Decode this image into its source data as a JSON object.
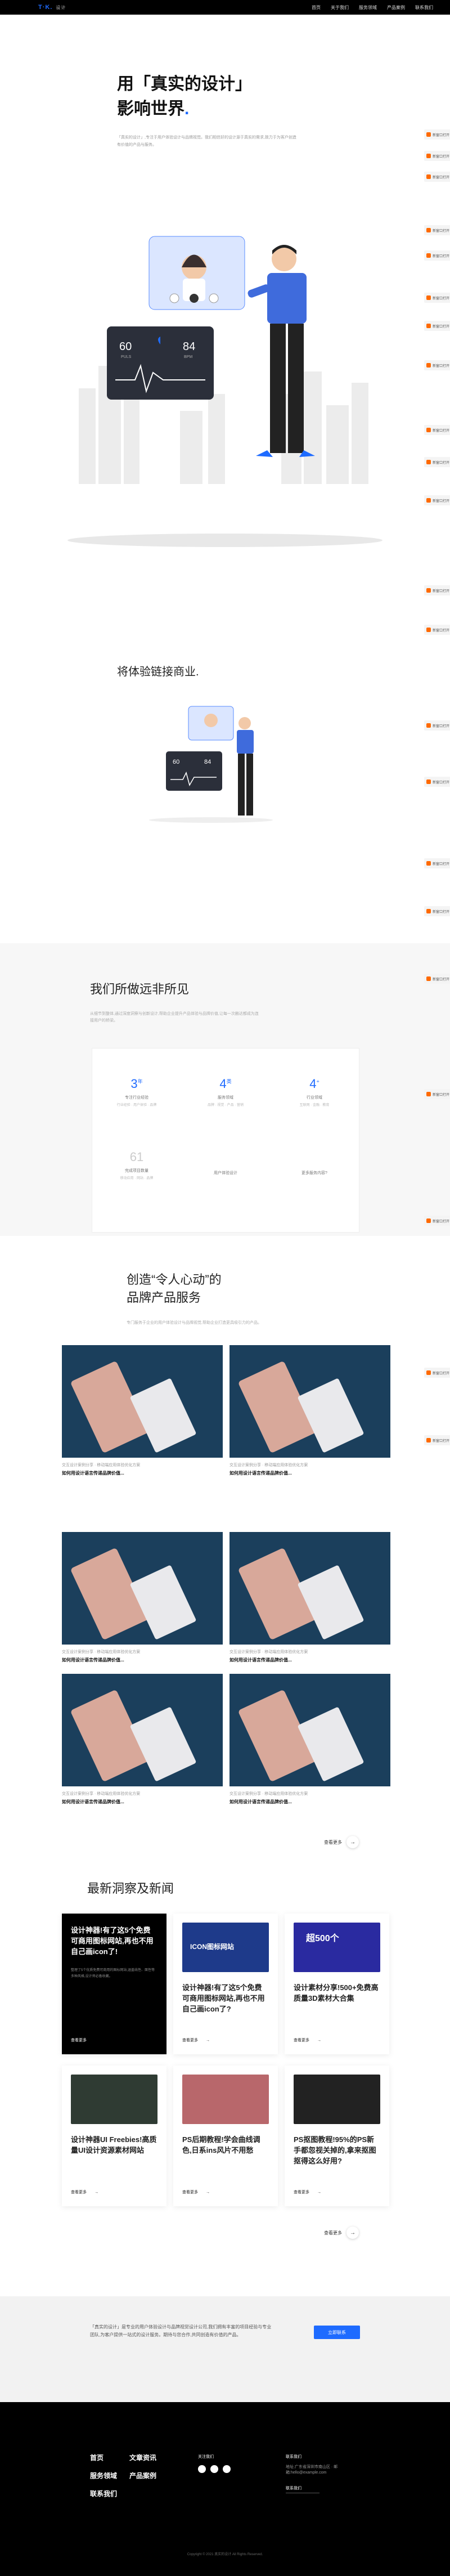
{
  "header": {
    "logo": "T·K.",
    "logo_sub": "设计",
    "nav": [
      "首页",
      "关于我们",
      "服务领域",
      "产品案例",
      "联系我们"
    ]
  },
  "hero": {
    "line1": "用「真实的设计」",
    "line2": "影响世界",
    "dot": ".",
    "desc": "「真实的设计」,专注于用户体验设计与品牌视觉。我们相信好的设计源于真实的需求,致力于为客户创造有价值的产品与服务。",
    "pulse": "60",
    "pulse_label": "PULS",
    "bpm": "84",
    "bpm_label": "BPM"
  },
  "side_tabs": [
    "新窗口打开",
    "新窗口打开",
    "新窗口打开",
    "新窗口打开",
    "新窗口打开",
    "新窗口打开",
    "新窗口打开",
    "新窗口打开",
    "新窗口打开",
    "新窗口打开",
    "新窗口打开",
    "新窗口打开",
    "新窗口打开",
    "新窗口打开",
    "新窗口打开",
    "新窗口打开",
    "新窗口打开",
    "新窗口打开",
    "新窗口打开",
    "新窗口打开",
    "新窗口打开",
    "新窗口打开"
  ],
  "experience": {
    "title": "将体验链接商业.",
    "pulse": "60",
    "bpm": "84"
  },
  "what": {
    "title": "我们所做远非所见",
    "desc": "从细节到整体,通过深度洞察与创新设计,帮助企业提升产品体验与品牌价值,让每一次触达都成为连接用户的桥梁。",
    "stats": [
      {
        "n": "3",
        "u": "年",
        "l": "专注行业经验",
        "d": "行业经验 · 用户体验 · 品牌"
      },
      {
        "n": "4",
        "u": "类",
        "l": "服务领域",
        "d": "品牌 · 视觉 · 产品 · 营销"
      },
      {
        "n": "4",
        "u": "+",
        "l": "行业领域",
        "d": "互联网 · 金融 · 教育"
      },
      {
        "n": "61",
        "u": "",
        "l": "完成项目数量",
        "d": "移动应用 · 网站 · 品牌"
      },
      {
        "n": "",
        "u": "",
        "l": "用户体验设计",
        "d": ""
      },
      {
        "n": "",
        "u": "",
        "l": "更多服务内容?",
        "d": ""
      }
    ]
  },
  "brand": {
    "title1": "创造“令人心动”的",
    "title2": "品牌产品服务",
    "desc": "专门服务于企业的用户体验设计与品牌视觉,帮助企业打造更具吸引力的产品。",
    "cards": [
      {
        "cap": "交互设计案例分享 · 移动端应用体验优化方案",
        "t": "如何用设计语言传递品牌价值..."
      },
      {
        "cap": "交互设计案例分享 · 移动端应用体验优化方案",
        "t": "如何用设计语言传递品牌价值..."
      },
      {
        "cap": "交互设计案例分享 · 移动端应用体验优化方案",
        "t": "如何用设计语言传递品牌价值..."
      },
      {
        "cap": "交互设计案例分享 · 移动端应用体验优化方案",
        "t": "如何用设计语言传递品牌价值..."
      },
      {
        "cap": "交互设计案例分享 · 移动端应用体验优化方案",
        "t": "如何用设计语言传递品牌价值..."
      },
      {
        "cap": "交互设计案例分享 · 移动端应用体验优化方案",
        "t": "如何用设计语言传递品牌价值..."
      }
    ],
    "more": "查看更多"
  },
  "news": {
    "title": "最新洞察及新闻",
    "more": "查看更多",
    "read": "查看更多",
    "items": [
      {
        "t": "设计神器!有了这5个免费可商用图标网站,再也不用自己画icon了!",
        "d": "整理了5个优质免费可商用的图标网站,涵盖线性、面性等多种风格,设计师必备收藏。"
      },
      {
        "t": "设计神器!有了这5个免费可商用图标网站,再也不用自己画icon了?",
        "d": "",
        "thumb": "ICON图标网站"
      },
      {
        "t": "设计素材分享!500+免费高质量3D素材大合集",
        "d": "",
        "thumb": "超500个"
      },
      {
        "t": "设计神器UI Freebies!高质量UI设计资源素材网站",
        "d": ""
      },
      {
        "t": "PS后期教程!学会曲线调色,日系ins风片不用愁",
        "d": ""
      },
      {
        "t": "PS抠图教程!95%的PS新手都忽视关掉的,拿来抠图抠得这么好用?",
        "d": ""
      }
    ]
  },
  "cta": {
    "text": "「真实的设计」是专业的用户体验设计与品牌视觉设计公司,我们拥有丰富的项目经验与专业团队,为客户提供一站式的设计服务。期待与您合作,共同创造有价值的产品。",
    "button": "立即联系"
  },
  "footer": {
    "links": [
      "首页",
      "文章资讯",
      "服务领域",
      "产品案例",
      "联系我们"
    ],
    "social_label": "关注我们",
    "contact_title": "联系我们",
    "contact_text": "地址:广东省深圳市南山区 · 邮箱:hello@example.com",
    "contact_btn": "联系我们",
    "copyright": "Copyright © 2021 真实的设计 All Rights Reserved."
  },
  "colors": {
    "accent": "#1e6bff",
    "dark": "#000000",
    "gray": "#f7f7f7"
  }
}
